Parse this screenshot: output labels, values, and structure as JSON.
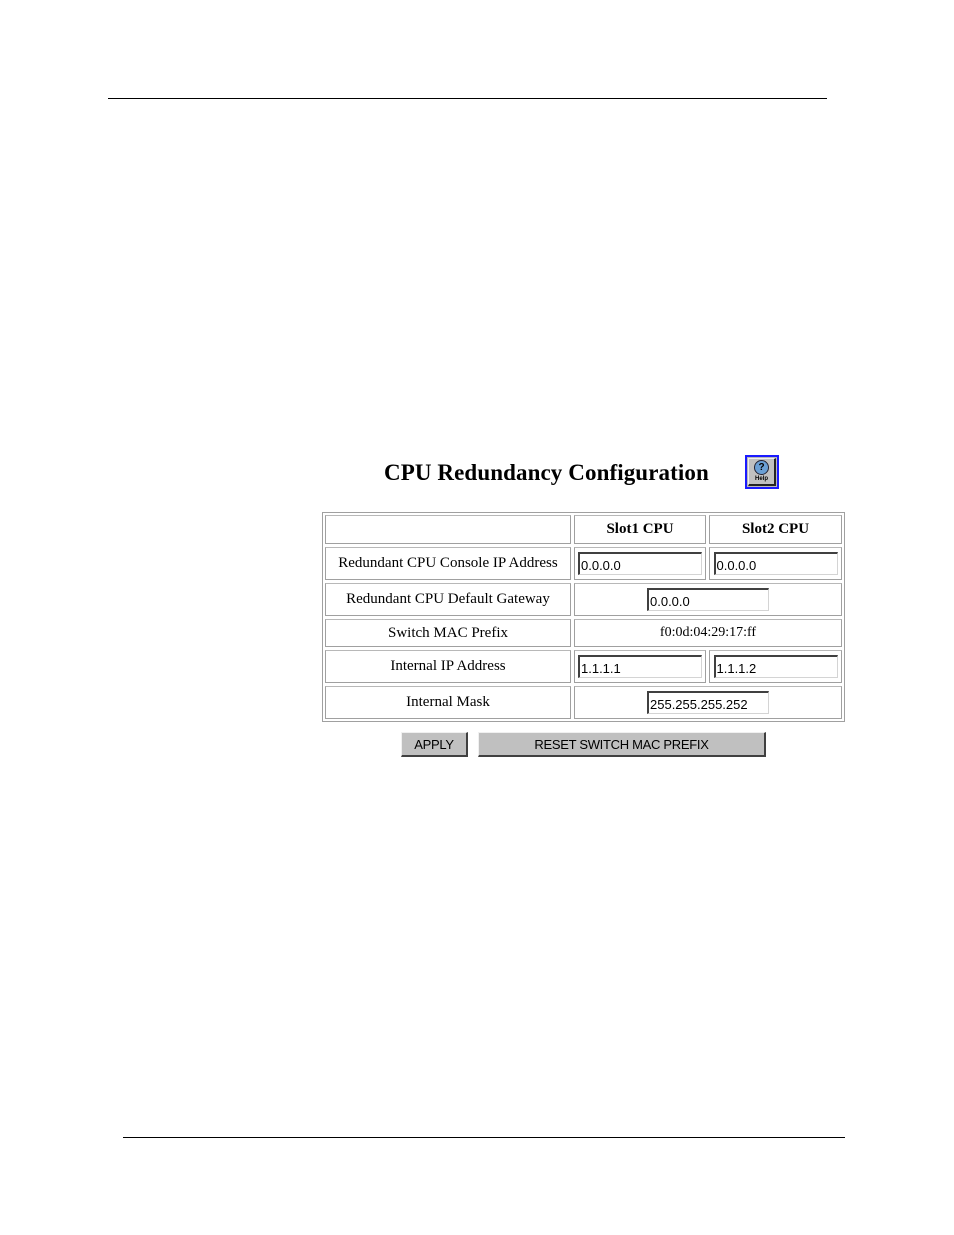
{
  "page": {
    "title": "CPU Redundancy Configuration",
    "help_label": "Help",
    "help_glyph": "?"
  },
  "table": {
    "headers": [
      "",
      "Slot1 CPU",
      "Slot2 CPU"
    ],
    "rows": [
      {
        "label": "Redundant CPU Console IP Address",
        "slot1_value": "0.0.0.0",
        "slot2_value": "0.0.0.0"
      },
      {
        "label": "Redundant CPU Default Gateway",
        "value": "0.0.0.0"
      },
      {
        "label": "Switch MAC Prefix",
        "value": "f0:0d:04:29:17:ff"
      },
      {
        "label": "Internal IP Address",
        "slot1_value": "1.1.1.1",
        "slot2_value": "1.1.1.2"
      },
      {
        "label": "Internal Mask",
        "value": "255.255.255.252"
      }
    ]
  },
  "buttons": {
    "apply": "APPLY",
    "reset_mac": "RESET SWITCH MAC PREFIX"
  },
  "icons": {
    "help": "help-icon"
  }
}
